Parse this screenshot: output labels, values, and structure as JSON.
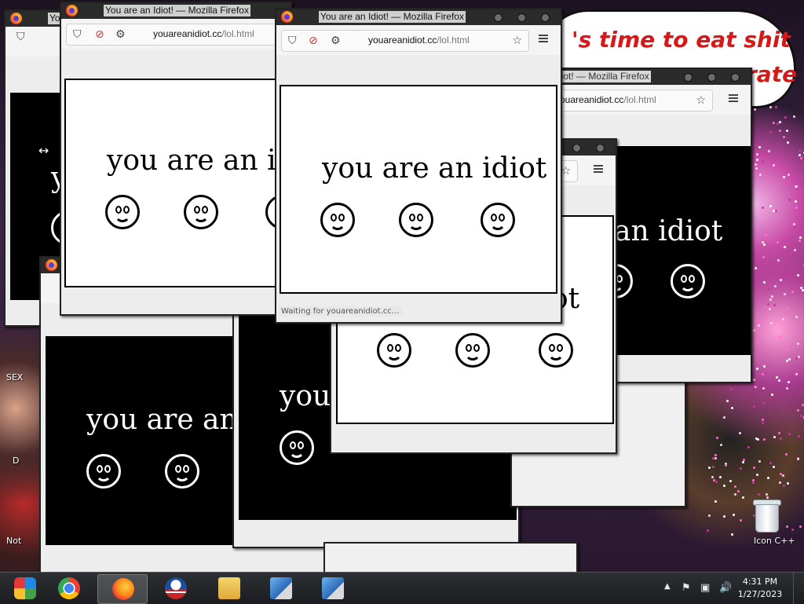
{
  "desktop": {
    "bubble_lines": [
      "'s time to eat shit",
      "rate"
    ],
    "labels": [
      "SEX",
      "Not",
      "D",
      "icon C++"
    ],
    "recycle_bin_label": "Icon C++"
  },
  "windows": [
    {
      "id": "w-back-left",
      "title": "You",
      "theme": "black",
      "message": "yo",
      "smiley_count": 1
    },
    {
      "id": "w-back-left-2",
      "title": "",
      "theme": "black",
      "message": "you are an i",
      "smiley_count": 2
    },
    {
      "id": "w-middle-black",
      "title": "",
      "theme": "black",
      "message": "you",
      "smiley_count": 1
    },
    {
      "id": "w-front-left",
      "title": "You are an Idiot! — Mozilla Firefox",
      "url_host": "youareanidiot.cc",
      "url_path": "/lol.html",
      "theme": "white",
      "message": "you are an idi",
      "smiley_count": 3
    },
    {
      "id": "w-front-center",
      "title": "You are an Idiot! — Mozilla Firefox",
      "url_host": "youareanidiot.cc",
      "url_path": "/lol.html",
      "theme": "white",
      "message": "you are an idiot",
      "smiley_count": 3,
      "status": "Waiting for youareanidiot.cc…"
    },
    {
      "id": "w-right",
      "title": "diot! — Mozilla Firefox",
      "url_host": "ouareanidiot.cc",
      "url_path": "/lol.html",
      "theme": "black",
      "message": "an idiot",
      "smiley_count": 2
    },
    {
      "id": "w-center-white",
      "title": "",
      "theme": "white",
      "message": "ot",
      "smiley_count": 3
    }
  ],
  "taskbar": {
    "apps": [
      "chrome-remote-desktop",
      "chrome",
      "firefox",
      "obama-logo",
      "file-explorer",
      "installer",
      "installer"
    ],
    "active_app": "firefox",
    "clock_time": "4:31 PM",
    "clock_date": "1/27/2023"
  },
  "icons": {
    "shield": "shield-icon",
    "permissions": "permissions-icon",
    "star": "bookmark-star-icon",
    "menu": "hamburger-menu-icon"
  }
}
